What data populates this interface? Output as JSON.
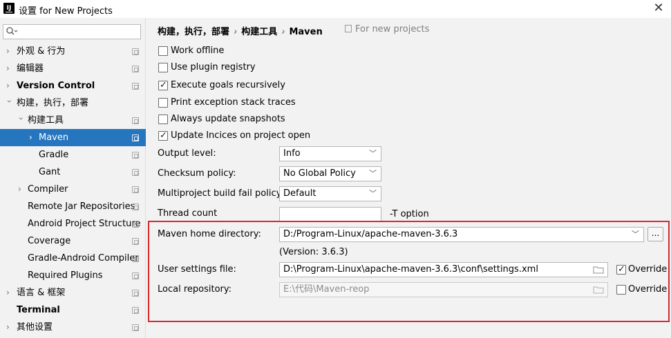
{
  "window": {
    "title": "设置 for New Projects",
    "logo_text": "IJ"
  },
  "sidebar": {
    "search_placeholder": "",
    "items": [
      {
        "label": "外观 & 行为"
      },
      {
        "label": "编辑器"
      },
      {
        "label": "Version Control"
      },
      {
        "label": "构建，执行，部署"
      },
      {
        "label": "构建工具"
      },
      {
        "label": "Maven"
      },
      {
        "label": "Gradle"
      },
      {
        "label": "Gant"
      },
      {
        "label": "Compiler"
      },
      {
        "label": "Remote Jar Repositories"
      },
      {
        "label": "Android Project Structure"
      },
      {
        "label": "Coverage"
      },
      {
        "label": "Gradle-Android Compiler"
      },
      {
        "label": "Required Plugins"
      },
      {
        "label": "语言 & 框架"
      },
      {
        "label": "Terminal"
      },
      {
        "label": "其他设置"
      }
    ]
  },
  "breadcrumb": {
    "items": [
      "构建，执行，部署",
      "构建工具",
      "Maven"
    ],
    "separator": "›",
    "for_new_projects": "For new projects"
  },
  "options": {
    "work_offline": {
      "label": "Work offline",
      "checked": false
    },
    "plugin_registry": {
      "label": "Use plugin registry",
      "checked": false
    },
    "execute_goals": {
      "label": "Execute goals recursively",
      "checked": true
    },
    "print_exception": {
      "label": "Print exception stack traces",
      "checked": false
    },
    "always_update": {
      "label": "Always update snapshots",
      "checked": false
    },
    "update_indices": {
      "label": "Update Incices on project open",
      "checked": true
    }
  },
  "fields": {
    "output_level": {
      "label": "Output level:",
      "value": "Info"
    },
    "checksum_policy": {
      "label": "Checksum policy:",
      "value": "No Global Policy"
    },
    "multiproject_policy": {
      "label": "Multiproject build fail policy:",
      "value": "Default"
    },
    "thread_count": {
      "label": "Thread count",
      "value": "",
      "suffix": "-T option"
    }
  },
  "maven": {
    "home_label": "Maven home directory:",
    "home_value": "D:/Program-Linux/apache-maven-3.6.3",
    "browse_label": "...",
    "version": "(Version: 3.6.3)",
    "settings_label": "User settings file:",
    "settings_value": "D:\\Program-Linux\\apache-maven-3.6.3\\conf\\settings.xml",
    "settings_override": {
      "label": "Override",
      "checked": true
    },
    "repo_label": "Local repository:",
    "repo_value": "E:\\代码\\Maven-reop",
    "repo_override": {
      "label": "Override",
      "checked": false
    }
  },
  "colors": {
    "selection": "#2675bf",
    "highlight_border": "#d9262b"
  }
}
